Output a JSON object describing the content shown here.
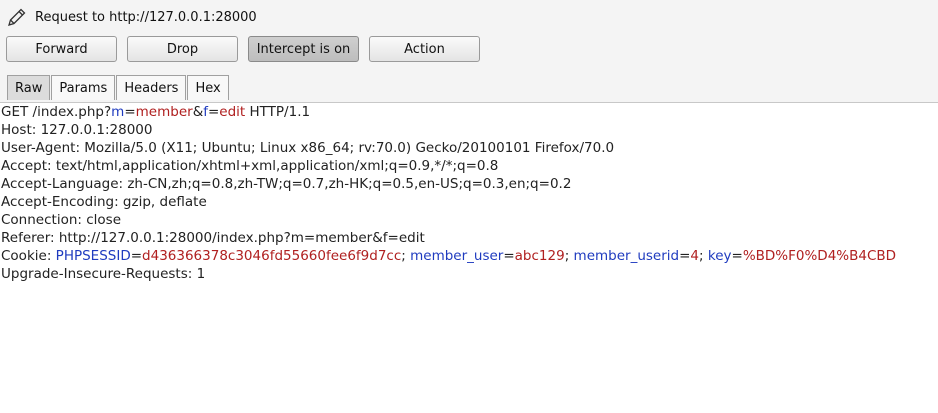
{
  "window": {
    "title": "Request to http://127.0.0.1:28000"
  },
  "toolbar": {
    "forward_label": "Forward",
    "drop_label": "Drop",
    "intercept_label": "Intercept is on",
    "action_label": "Action"
  },
  "tabs": [
    {
      "label": "Raw",
      "active": true
    },
    {
      "label": "Params",
      "active": false
    },
    {
      "label": "Headers",
      "active": false
    },
    {
      "label": "Hex",
      "active": false
    }
  ],
  "request": {
    "line1": {
      "prefix": "GET /index.php?",
      "p1_name": "m",
      "p1_eq": "=",
      "p1_val": "member",
      "amp": "&",
      "p2_name": "f",
      "p2_eq": "=",
      "p2_val": "edit",
      "suffix": " HTTP/1.1"
    },
    "host": "Host: 127.0.0.1:28000",
    "user_agent": "User-Agent: Mozilla/5.0 (X11; Ubuntu; Linux x86_64; rv:70.0) Gecko/20100101 Firefox/70.0",
    "accept": "Accept: text/html,application/xhtml+xml,application/xml;q=0.9,*/*;q=0.8",
    "accept_language": "Accept-Language: zh-CN,zh;q=0.8,zh-TW;q=0.7,zh-HK;q=0.5,en-US;q=0.3,en;q=0.2",
    "accept_encoding": "Accept-Encoding: gzip, deflate",
    "connection": "Connection: close",
    "referer": "Referer: http://127.0.0.1:28000/index.php?m=member&f=edit",
    "cookie": {
      "prefix": "Cookie: ",
      "c1_name": "PHPSESSID",
      "c1_val": "d436366378c3046fd55660fee6f9d7cc",
      "c2_name": "member_user",
      "c2_val": "abc129",
      "c3_name": "member_userid",
      "c3_val": "4",
      "c4_name": "key",
      "c4_val": "%BD%F0%D4%B4CBD",
      "eq": "=",
      "sep": "; "
    },
    "upgrade": "Upgrade-Insecure-Requests: 1"
  },
  "colors": {
    "param_name": "#1f3bbf",
    "param_value": "#b02020"
  },
  "icons": {
    "title": "pencil-icon"
  }
}
